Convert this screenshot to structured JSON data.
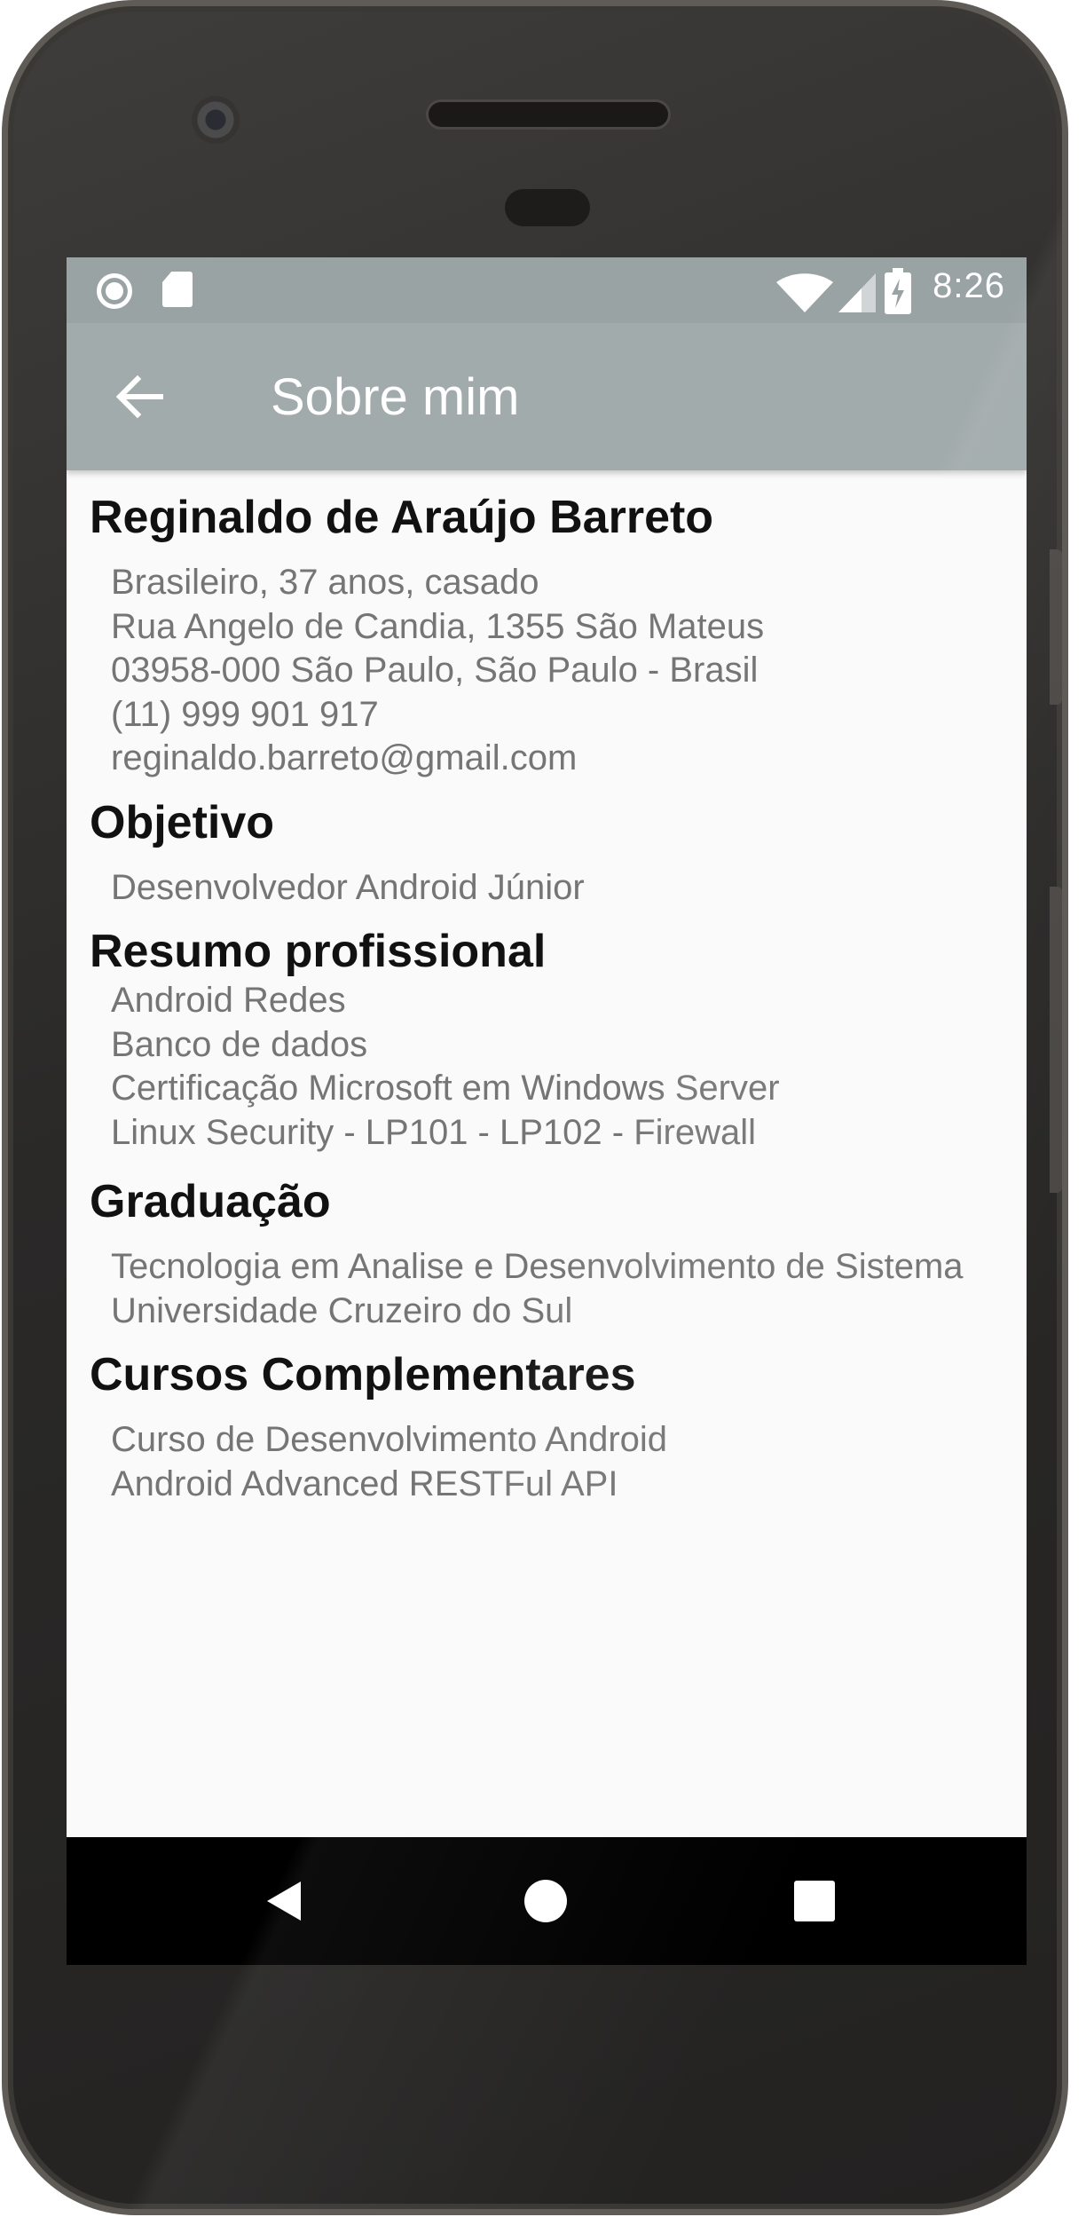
{
  "status_bar": {
    "time": "8:26",
    "left_icons": [
      "sync-circle-icon",
      "sd-card-icon"
    ],
    "right_icons": [
      "wifi-icon",
      "signal-icon",
      "battery-charging-icon"
    ]
  },
  "toolbar": {
    "title": "Sobre mim",
    "back_icon": "arrow-back-icon"
  },
  "sections": [
    {
      "title": "Reginaldo de Araújo Barreto",
      "lines": [
        "Brasileiro, 37 anos, casado",
        "Rua Angelo de Candia, 1355 São Mateus",
        "03958-000 São Paulo, São Paulo - Brasil",
        "(11) 999 901 917",
        "reginaldo.barreto@gmail.com"
      ]
    },
    {
      "title": "Objetivo",
      "lines": [
        "Desenvolvedor Android Júnior"
      ]
    },
    {
      "title": "Resumo profissional",
      "lines": [
        "Android Redes",
        "Banco de dados",
        "Certificação Microsoft em Windows Server",
        "Linux Security - LP101 - LP102 - Firewall"
      ]
    },
    {
      "title": "Graduação",
      "lines": [
        "Tecnologia em Analise e Desenvolvimento de Sistema",
        "Universidade Cruzeiro do Sul"
      ]
    },
    {
      "title": "Cursos Complementares",
      "lines": [
        "Curso de Desenvolvimento Android",
        "Android Advanced RESTFul API"
      ]
    }
  ],
  "nav_bar": {
    "buttons": [
      "nav-back-icon",
      "nav-home-icon",
      "nav-recents-icon"
    ]
  },
  "colors": {
    "app_bar": "#a2abac",
    "status_bar": "#9aa3a4",
    "background": "#fafafa",
    "title_text": "#111111",
    "body_text": "#757575",
    "nav_bar": "#000000"
  }
}
